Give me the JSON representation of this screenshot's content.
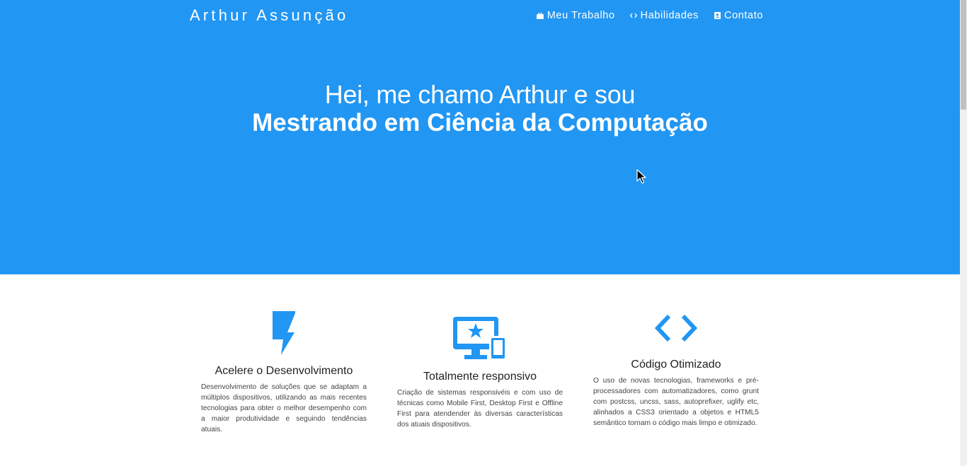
{
  "header": {
    "brand": "Arthur Assunção",
    "nav": [
      {
        "label": "Meu Trabalho",
        "icon": "briefcase-icon"
      },
      {
        "label": "Habilidades",
        "icon": "code-icon"
      },
      {
        "label": "Contato",
        "icon": "contact-card-icon"
      }
    ]
  },
  "hero": {
    "line1": "Hei, me chamo Arthur e sou",
    "line2": "Mestrando em Ciência da Computação"
  },
  "features": [
    {
      "icon": "lightning-bolt-icon",
      "title": "Acelere o Desenvolvimento",
      "description": "Desenvolvimento de soluções que se adaptam a múltiplos dispositivos, utilizando as mais recentes tecnologias para obter o melhor desempenho com a maior produtividade e seguindo tendências atuais."
    },
    {
      "icon": "responsive-devices-icon",
      "title": "Totalmente responsivo",
      "description": "Criação de sistemas responsivéis e com uso de técnicas como Mobile First, Desktop First e Offline First para atendender às diversas características dos atuais dispositivos."
    },
    {
      "icon": "code-brackets-icon",
      "title": "Código Otimizado",
      "description": "O uso de novas tecnologias, frameworks e pré-processadores com automatizadores, como grunt com postcss, uncss, sass, autoprefixer, uglify etc, alinhados a CSS3 orientado a objetos e HTML5 semântico tornam o código mais limpo e otimizado."
    }
  ],
  "colors": {
    "primary": "#2196f3",
    "text_dark": "#212121"
  }
}
